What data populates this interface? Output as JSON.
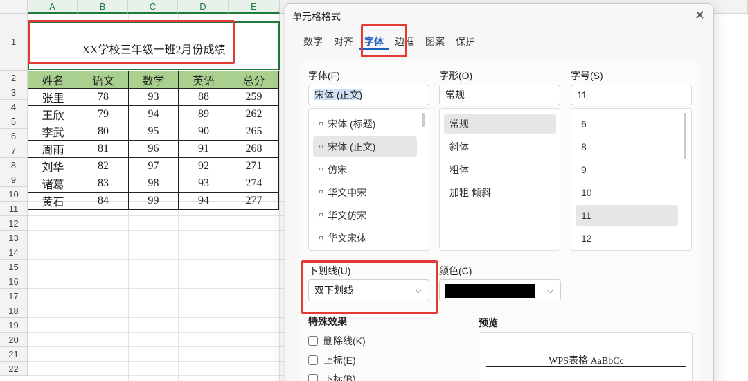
{
  "sheet": {
    "columns": [
      "A",
      "B",
      "C",
      "D",
      "E"
    ],
    "rows": [
      "1",
      "2",
      "3",
      "4",
      "5",
      "6",
      "7",
      "8",
      "9",
      "10",
      "11",
      "12",
      "13",
      "14",
      "15",
      "16",
      "17",
      "18",
      "19",
      "20",
      "21",
      "22"
    ],
    "title": "XX学校三年级一班2月份成绩",
    "headers": [
      "姓名",
      "语文",
      "数学",
      "英语",
      "总分"
    ],
    "data": [
      [
        "张里",
        "78",
        "93",
        "88",
        "259"
      ],
      [
        "王欣",
        "79",
        "94",
        "89",
        "262"
      ],
      [
        "李武",
        "80",
        "95",
        "90",
        "265"
      ],
      [
        "周雨",
        "81",
        "96",
        "91",
        "268"
      ],
      [
        "刘华",
        "82",
        "97",
        "92",
        "271"
      ],
      [
        "诸葛",
        "83",
        "98",
        "93",
        "274"
      ],
      [
        "黄石",
        "84",
        "99",
        "94",
        "277"
      ]
    ],
    "header_fill_color": "#a9d08e",
    "selection_color": "#1f7a3e"
  },
  "dialog": {
    "title": "单元格格式",
    "tabs": [
      "数字",
      "对齐",
      "字体",
      "边框",
      "图案",
      "保护"
    ],
    "active_tab": "字体",
    "font": {
      "label": "字体(F)",
      "value": "宋体 (正文)",
      "options": [
        "宋体 (标题)",
        "宋体 (正文)",
        "仿宋",
        "华文中宋",
        "华文仿宋",
        "华文宋体"
      ],
      "selected": "宋体 (正文)"
    },
    "style": {
      "label": "字形(O)",
      "value": "常规",
      "options": [
        "常规",
        "斜体",
        "粗体",
        "加粗 倾斜"
      ],
      "selected": "常规"
    },
    "size": {
      "label": "字号(S)",
      "value": "11",
      "options": [
        "6",
        "8",
        "9",
        "10",
        "11",
        "12"
      ],
      "selected": "11"
    },
    "underline": {
      "label": "下划线(U)",
      "value": "双下划线"
    },
    "color": {
      "label": "颜色(C)",
      "value": "#000000"
    },
    "effects": {
      "label": "特殊效果",
      "items": [
        "删除线(K)",
        "上标(E)",
        "下标(B)"
      ]
    },
    "preview": {
      "label": "预览",
      "text": "WPS表格   AaBbCc"
    },
    "highlight_color": "#e53935"
  }
}
